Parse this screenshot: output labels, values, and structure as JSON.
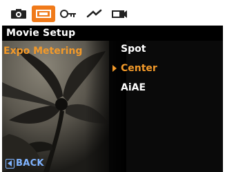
{
  "tabs": [
    {
      "icon": "camera-icon",
      "active": false
    },
    {
      "icon": "video-icon",
      "active": true
    },
    {
      "icon": "key-icon",
      "active": false
    },
    {
      "icon": "tools-icon",
      "active": false
    },
    {
      "icon": "playback-icon",
      "active": false
    }
  ],
  "title": "Movie Setup",
  "menu": {
    "label": "Expo Metering",
    "options": [
      "Spot",
      "Center",
      "AiAE"
    ],
    "selected": "Center"
  },
  "back": {
    "label": "BACK"
  },
  "colors": {
    "accent": "#f07a1a",
    "highlight_text": "#f39a2a",
    "back": "#7fb3ff"
  }
}
